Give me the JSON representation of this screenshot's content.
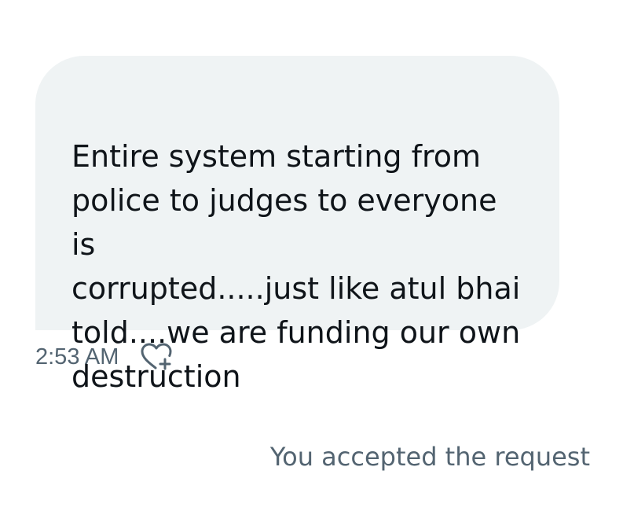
{
  "message": {
    "text": "Entire system starting from\npolice to judges to everyone is\ncorrupted.....just like atul bhai\ntold....we are funding our own\ndestruction",
    "timestamp": "2:53 AM",
    "react_icon": "heart-plus-icon"
  },
  "system_notice": {
    "text": "You accepted the request"
  },
  "colors": {
    "bubble_bg": "#eff3f4",
    "text": "#0f1419",
    "secondary": "#536471"
  }
}
